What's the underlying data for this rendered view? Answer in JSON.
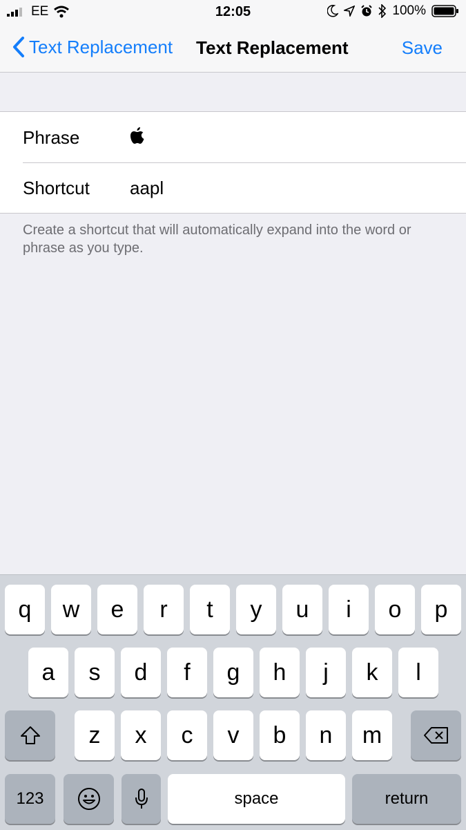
{
  "status": {
    "carrier": "EE",
    "time": "12:05",
    "battery": "100%"
  },
  "nav": {
    "back_label": "Text Replacement",
    "title": "Text Replacement",
    "save_label": "Save"
  },
  "form": {
    "phrase_label": "Phrase",
    "phrase_value": "",
    "shortcut_label": "Shortcut",
    "shortcut_value": "aapl"
  },
  "footer_text": "Create a shortcut that will automatically expand into the word or phrase as you type.",
  "keyboard": {
    "row1": [
      "q",
      "w",
      "e",
      "r",
      "t",
      "y",
      "u",
      "i",
      "o",
      "p"
    ],
    "row2": [
      "a",
      "s",
      "d",
      "f",
      "g",
      "h",
      "j",
      "k",
      "l"
    ],
    "row3": [
      "z",
      "x",
      "c",
      "v",
      "b",
      "n",
      "m"
    ],
    "numbers_label": "123",
    "space_label": "space",
    "return_label": "return"
  },
  "colors": {
    "accent": "#147efb",
    "background": "#efeff4",
    "keyboard_bg": "#d1d5db",
    "dark_key": "#acb3bc"
  }
}
